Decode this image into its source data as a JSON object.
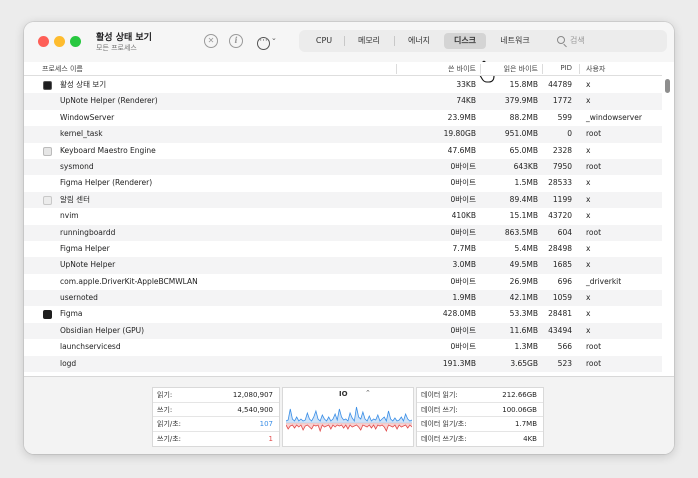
{
  "app": {
    "title": "활성 상태 보기",
    "subtitle": "모든 프로세스"
  },
  "toolbar": {
    "stop_icon": "x-circle-icon",
    "info_icon": "info-circle-icon",
    "more_icon": "ellipsis-circle-icon",
    "stop_glyph": "✕",
    "info_glyph": "i",
    "more_glyph": "···",
    "more_chevron": "⌄"
  },
  "tabs": [
    {
      "label": "CPU"
    },
    {
      "label": "메모리"
    },
    {
      "label": "에너지"
    },
    {
      "label": "디스크",
      "selected": true
    },
    {
      "label": "네트워크"
    }
  ],
  "search": {
    "placeholder": "검색"
  },
  "columns": {
    "name": "프로세스 이름",
    "written": "쓴 바이트",
    "read": "읽은 바이트",
    "pid": "PID",
    "user": "사용자"
  },
  "rows": [
    {
      "name": "활성 상태 보기",
      "written": "33KB",
      "read": "15.8MB",
      "pid": "44789",
      "user": "x",
      "icon": "activity-monitor-icon"
    },
    {
      "name": "UpNote Helper (Renderer)",
      "written": "74KB",
      "read": "379.9MB",
      "pid": "1772",
      "user": "x"
    },
    {
      "name": "WindowServer",
      "written": "23.9MB",
      "read": "88.2MB",
      "pid": "599",
      "user": "_windowserver"
    },
    {
      "name": "kernel_task",
      "written": "19.80GB",
      "read": "951.0MB",
      "pid": "0",
      "user": "root"
    },
    {
      "name": "Keyboard Maestro Engine",
      "written": "47.6MB",
      "read": "65.0MB",
      "pid": "2328",
      "user": "x",
      "icon": "keyboard-maestro-icon"
    },
    {
      "name": "sysmond",
      "written": "0바이트",
      "read": "643KB",
      "pid": "7950",
      "user": "root"
    },
    {
      "name": "Figma Helper (Renderer)",
      "written": "0바이트",
      "read": "1.5MB",
      "pid": "28533",
      "user": "x"
    },
    {
      "name": "알림 센터",
      "written": "0바이트",
      "read": "89.4MB",
      "pid": "1199",
      "user": "x",
      "icon": "notification-center-icon"
    },
    {
      "name": "nvim",
      "written": "410KB",
      "read": "15.1MB",
      "pid": "43720",
      "user": "x"
    },
    {
      "name": "runningboardd",
      "written": "0바이트",
      "read": "863.5MB",
      "pid": "604",
      "user": "root"
    },
    {
      "name": "Figma Helper",
      "written": "7.7MB",
      "read": "5.4MB",
      "pid": "28498",
      "user": "x"
    },
    {
      "name": "UpNote Helper",
      "written": "3.0MB",
      "read": "49.5MB",
      "pid": "1685",
      "user": "x"
    },
    {
      "name": "com.apple.DriverKit-AppleBCMWLAN",
      "written": "0바이트",
      "read": "26.9MB",
      "pid": "696",
      "user": "_driverkit"
    },
    {
      "name": "usernoted",
      "written": "1.9MB",
      "read": "42.1MB",
      "pid": "1059",
      "user": "x"
    },
    {
      "name": "Figma",
      "written": "428.0MB",
      "read": "53.3MB",
      "pid": "28481",
      "user": "x",
      "icon": "figma-icon"
    },
    {
      "name": "Obsidian Helper (GPU)",
      "written": "0바이트",
      "read": "11.6MB",
      "pid": "43494",
      "user": "x"
    },
    {
      "name": "launchservicesd",
      "written": "0바이트",
      "read": "1.3MB",
      "pid": "566",
      "user": "root"
    },
    {
      "name": "logd",
      "written": "191.3MB",
      "read": "3.65GB",
      "pid": "523",
      "user": "root"
    }
  ],
  "stats_left": [
    {
      "label": "읽기:",
      "value": "12,080,907",
      "color": ""
    },
    {
      "label": "쓰기:",
      "value": "4,540,900",
      "color": ""
    },
    {
      "label": "읽기/초:",
      "value": "107",
      "color": "blue"
    },
    {
      "label": "쓰기/초:",
      "value": "1",
      "color": "red"
    }
  ],
  "io": {
    "label": "IO",
    "select_glyph": "⌃",
    "read_color": "#3a8ee6",
    "write_color": "#e24a4a",
    "read_series": [
      0.1,
      0.15,
      0.7,
      0.2,
      0.1,
      0.3,
      0.1,
      0.2,
      0.1,
      0.15,
      0.5,
      0.2,
      0.1,
      0.3,
      0.6,
      0.2,
      0.1,
      0.4,
      0.2,
      0.1,
      0.3,
      0.1,
      0.2,
      0.45,
      0.15,
      0.7,
      0.3,
      0.15,
      0.2,
      0.1,
      0.5,
      0.25,
      0.1,
      0.8,
      0.3,
      0.2,
      0.55,
      0.2,
      0.1,
      0.35,
      0.1,
      0.2,
      0.15,
      0.4,
      0.1,
      0.2,
      0.3,
      0.1,
      0.6,
      0.2,
      0.1,
      0.25,
      0.1,
      0.15,
      0.3,
      0.1,
      0.45,
      0.2,
      0.1,
      0.15
    ],
    "write_series": [
      0.1,
      0.3,
      0.15,
      0.1,
      0.25,
      0.1,
      0.2,
      0.1,
      0.35,
      0.15,
      0.1,
      0.2,
      0.3,
      0.1,
      0.15,
      0.1,
      0.4,
      0.1,
      0.2,
      0.15,
      0.1,
      0.3,
      0.1,
      0.2,
      0.1,
      0.15,
      0.1,
      0.25,
      0.1,
      0.3,
      0.1,
      0.2,
      0.15,
      0.1,
      0.2,
      0.35,
      0.1,
      0.15,
      0.2,
      0.1,
      0.25,
      0.1,
      0.3,
      0.1,
      0.15,
      0.1,
      0.2,
      0.4,
      0.1,
      0.15,
      0.2,
      0.1,
      0.3,
      0.1,
      0.2,
      0.15,
      0.1,
      0.25,
      0.1,
      0.2
    ]
  },
  "stats_right": [
    {
      "label": "데이터 읽기:",
      "value": "212.66GB"
    },
    {
      "label": "데이터 쓰기:",
      "value": "100.06GB"
    },
    {
      "label": "데이터 읽기/초:",
      "value": "1.7MB"
    },
    {
      "label": "데이터 쓰기/초:",
      "value": "4KB"
    }
  ]
}
